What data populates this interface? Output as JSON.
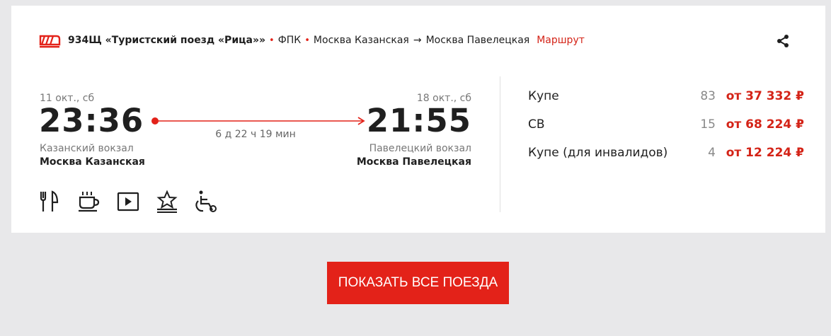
{
  "train": {
    "name": "934Щ «Туристский поезд «Рица»»",
    "carrier": "ФПК",
    "from": "Москва Казанская",
    "arrow": "→",
    "to": "Москва Павелецкая",
    "route_link": "Маршрут",
    "separator": "•"
  },
  "departure": {
    "date": "11 окт., сб",
    "time": "23:36",
    "station": "Казанский вокзал",
    "city": "Москва Казанская"
  },
  "arrival": {
    "date": "18 окт., сб",
    "time": "21:55",
    "station": "Павелецкий вокзал",
    "city": "Москва Павелецкая"
  },
  "duration": "6 д 22 ч 19 мин",
  "amenities": [
    "restaurant-icon",
    "coffee-icon",
    "video-icon",
    "tourist-star-icon",
    "wheelchair-icon"
  ],
  "fares": [
    {
      "class": "Купе",
      "seats": "83",
      "price": "от 37 332 ₽"
    },
    {
      "class": "СВ",
      "seats": "15",
      "price": "от 68 224 ₽"
    },
    {
      "class": "Купе (для инвалидов)",
      "seats": "4",
      "price": "от 12 224 ₽"
    }
  ],
  "show_all_button": "ПОКАЗАТЬ ВСЕ ПОЕЗДА",
  "colors": {
    "accent": "#e32219",
    "price": "#d42317",
    "background": "#e8e8ea"
  }
}
